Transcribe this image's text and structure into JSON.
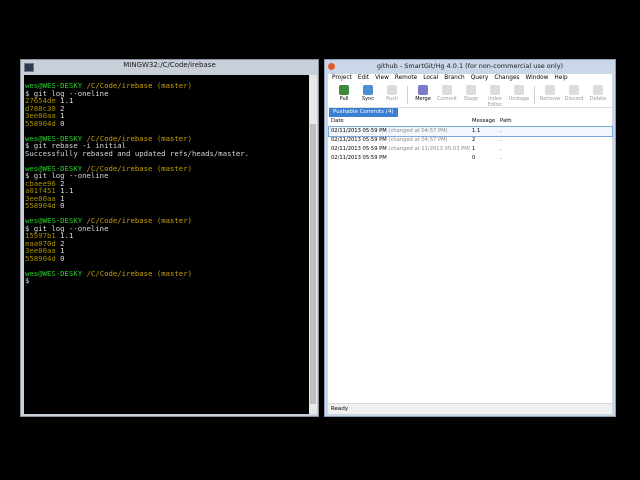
{
  "terminal": {
    "title": "MINGW32:/C/Code/irebase",
    "lines": [
      {
        "type": "prompt",
        "user": "wes@WES-DESKY",
        "path": "/C/Code/irebase",
        "branch": "(master)"
      },
      {
        "type": "cmd",
        "text": "$ git log --oneline"
      },
      {
        "type": "commit",
        "hash": "27654de",
        "msg": "1.1"
      },
      {
        "type": "commit",
        "hash": "d788c30",
        "msg": "2"
      },
      {
        "type": "commit",
        "hash": "3ee80aa",
        "msg": "1"
      },
      {
        "type": "commit",
        "hash": "558904d",
        "msg": "0"
      },
      {
        "type": "blank"
      },
      {
        "type": "prompt",
        "user": "wes@WES-DESKY",
        "path": "/C/Code/irebase",
        "branch": "(master)"
      },
      {
        "type": "cmd",
        "text": "$ git rebase -i initial"
      },
      {
        "type": "out",
        "text": "Successfully rebased and updated refs/heads/master."
      },
      {
        "type": "blank"
      },
      {
        "type": "prompt",
        "user": "wes@WES-DESKY",
        "path": "/C/Code/irebase",
        "branch": "(master)"
      },
      {
        "type": "cmd",
        "text": "$ git log --oneline"
      },
      {
        "type": "commit",
        "hash": "cbaee96",
        "msg": "2"
      },
      {
        "type": "commit",
        "hash": "a01f451",
        "msg": "1.1"
      },
      {
        "type": "commit",
        "hash": "3ee80aa",
        "msg": "1"
      },
      {
        "type": "commit",
        "hash": "558904d",
        "msg": "0"
      },
      {
        "type": "blank"
      },
      {
        "type": "prompt",
        "user": "wes@WES-DESKY",
        "path": "/C/Code/irebase",
        "branch": "(master)"
      },
      {
        "type": "cmd",
        "text": "$ git log --oneline"
      },
      {
        "type": "commit",
        "hash": "15597b1",
        "msg": "1.1"
      },
      {
        "type": "commit",
        "hash": "eaa070d",
        "msg": "2"
      },
      {
        "type": "commit",
        "hash": "3ee80aa",
        "msg": "1"
      },
      {
        "type": "commit",
        "hash": "558904d",
        "msg": "0"
      },
      {
        "type": "blank"
      },
      {
        "type": "prompt",
        "user": "wes@WES-DESKY",
        "path": "/C/Code/irebase",
        "branch": "(master)"
      },
      {
        "type": "cmd",
        "text": "$"
      }
    ]
  },
  "smartgit": {
    "title": "github - SmartGit/Hg 4.0.1 (for non-commercial use only)",
    "menu": [
      "Project",
      "Edit",
      "View",
      "Remote",
      "Local",
      "Branch",
      "Query",
      "Changes",
      "Window",
      "Help"
    ],
    "toolbar": [
      {
        "label": "Pull",
        "icon": "pull-icon",
        "enabled": true
      },
      {
        "label": "Sync",
        "icon": "sync-icon",
        "enabled": true
      },
      {
        "label": "Push",
        "icon": "push-icon",
        "enabled": false
      },
      {
        "sep": true
      },
      {
        "label": "Merge",
        "icon": "merge-icon",
        "enabled": true
      },
      {
        "label": "Commit",
        "icon": "commit-icon",
        "enabled": false
      },
      {
        "label": "Stage",
        "icon": "stage-icon",
        "enabled": false
      },
      {
        "label": "Index Editor",
        "icon": "index-editor-icon",
        "enabled": false
      },
      {
        "label": "Unstage",
        "icon": "unstage-icon",
        "enabled": false
      },
      {
        "sep": true
      },
      {
        "label": "Remove",
        "icon": "remove-icon",
        "enabled": false
      },
      {
        "label": "Discard",
        "icon": "discard-icon",
        "enabled": false
      },
      {
        "label": "Delete",
        "icon": "delete-icon",
        "enabled": false
      }
    ],
    "tab": "Pushable Commits (4)",
    "columns": [
      "Date",
      "Message",
      "Path"
    ],
    "rows": [
      {
        "date": "02/11/2013 05:59 PM",
        "note": "(changed at 04:57 PM)",
        "msg": "1.1",
        "path": "."
      },
      {
        "date": "02/11/2013 05:59 PM",
        "note": "(changed at 04:57 PM)",
        "msg": "2",
        "path": "."
      },
      {
        "date": "02/11/2013 05:59 PM",
        "note": "(changed at 11/2013 05:03 PM)",
        "msg": "1",
        "path": "."
      },
      {
        "date": "02/11/2013 05:59 PM",
        "note": "",
        "msg": "0",
        "path": "."
      }
    ],
    "status": "Ready"
  }
}
